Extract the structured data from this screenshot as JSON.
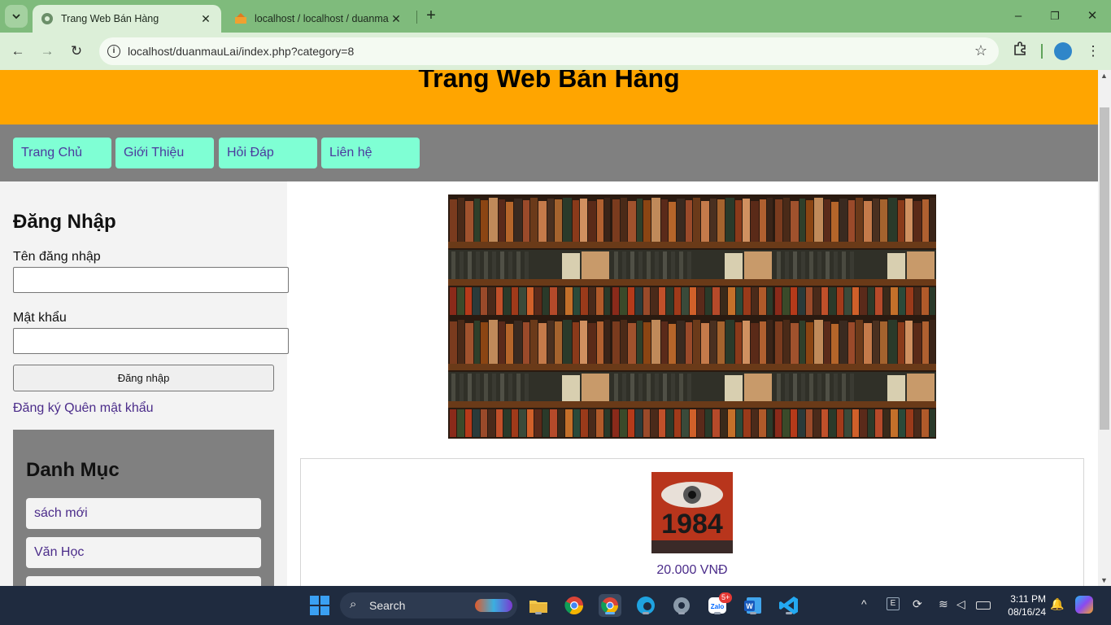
{
  "browser": {
    "tabs": [
      {
        "title": "Trang Web Bán Hàng",
        "active": true
      },
      {
        "title": "localhost / localhost / duanmau",
        "active": false
      }
    ],
    "url": "localhost/duanmauLai/index.php?category=8",
    "icons": {
      "tab_menu": "chevron-down-icon",
      "close": "close-icon",
      "new_tab": "plus-icon",
      "back": "arrow-left-icon",
      "forward": "arrow-right-icon",
      "reload": "reload-icon",
      "site_info": "info-icon",
      "bookmark": "star-icon",
      "extensions": "puzzle-icon",
      "menu": "kebab-menu-icon"
    },
    "window_controls": {
      "minimize": "–",
      "restore": "❐",
      "close": "✕"
    },
    "colors": {
      "chrome": "#7fbb7c",
      "toolbar": "#dcefd8"
    }
  },
  "page": {
    "header_title": "Trang Web Bán Hàng",
    "nav": [
      "Trang Chủ",
      "Giới Thiệu",
      "Hỏi Đáp",
      "Liên hệ"
    ],
    "login": {
      "title": "Đăng Nhập",
      "username_label": "Tên đăng nhập",
      "password_label": "Mật khẩu",
      "submit_label": "Đăng nhập",
      "register_link": "Đăng ký",
      "forgot_link": "Quên mật khẩu"
    },
    "category": {
      "title": "Danh Mục",
      "items": [
        "sách mới",
        "Văn Học"
      ]
    },
    "product": {
      "cover_text": "1984",
      "price": "20.000 VNĐ"
    },
    "colors": {
      "header": "#ffa500",
      "nav_bar": "#808080",
      "nav_item": "#7fffd4",
      "link": "#4b2c8a"
    }
  },
  "taskbar": {
    "search_placeholder": "Search",
    "zalo_badge": "5+",
    "time": "3:11 PM",
    "date": "08/16/24"
  }
}
